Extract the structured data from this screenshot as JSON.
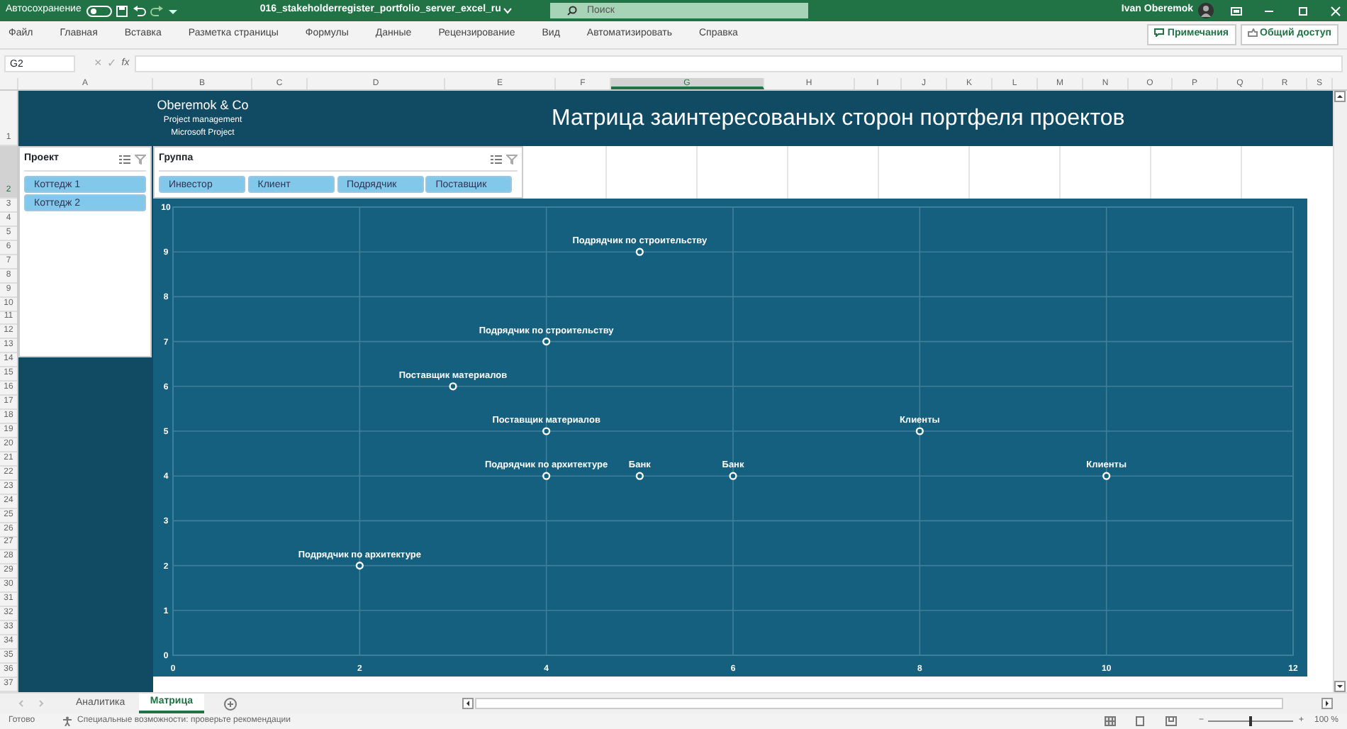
{
  "title_bar": {
    "autosave_label": "Автосохранение",
    "autosave_on": false,
    "filename": "016_stakeholderregister_portfolio_server_excel_ru",
    "search_placeholder": "Поиск",
    "user": "Ivan Oberemok"
  },
  "ribbon_tabs": [
    "Файл",
    "Главная",
    "Вставка",
    "Разметка страницы",
    "Формулы",
    "Данные",
    "Рецензирование",
    "Вид",
    "Автоматизировать",
    "Справка"
  ],
  "ribbon_buttons": [
    "Примечания",
    "Общий доступ"
  ],
  "formula_bar": {
    "name_box": "G2",
    "cancel": "×",
    "enter": "✓",
    "function": "fx"
  },
  "columns": [
    {
      "label": "A",
      "selected": false
    },
    {
      "label": "B",
      "selected": false
    },
    {
      "label": "C",
      "selected": false
    },
    {
      "label": "D",
      "selected": false
    },
    {
      "label": "E",
      "selected": false
    },
    {
      "label": "F",
      "selected": false
    },
    {
      "label": "G",
      "selected": true
    },
    {
      "label": "H",
      "selected": false
    },
    {
      "label": "I",
      "selected": false
    },
    {
      "label": "J",
      "selected": false
    },
    {
      "label": "K",
      "selected": false
    },
    {
      "label": "L",
      "selected": false
    },
    {
      "label": "M",
      "selected": false
    },
    {
      "label": "N",
      "selected": false
    },
    {
      "label": "O",
      "selected": false
    },
    {
      "label": "P",
      "selected": false
    },
    {
      "label": "Q",
      "selected": false
    },
    {
      "label": "R",
      "selected": false
    },
    {
      "label": "S",
      "selected": false
    }
  ],
  "rows": [
    {
      "label": "1",
      "selected": false
    },
    {
      "label": "2",
      "selected": true
    },
    {
      "label": "3",
      "selected": false
    },
    {
      "label": "4",
      "selected": false
    },
    {
      "label": "5",
      "selected": false
    },
    {
      "label": "6",
      "selected": false
    },
    {
      "label": "7",
      "selected": false
    },
    {
      "label": "8",
      "selected": false
    },
    {
      "label": "9",
      "selected": false
    },
    {
      "label": "10",
      "selected": false
    },
    {
      "label": "11",
      "selected": false
    },
    {
      "label": "12",
      "selected": false
    },
    {
      "label": "13",
      "selected": false
    },
    {
      "label": "14",
      "selected": false
    },
    {
      "label": "15",
      "selected": false
    },
    {
      "label": "16",
      "selected": false
    },
    {
      "label": "17",
      "selected": false
    },
    {
      "label": "18",
      "selected": false
    },
    {
      "label": "19",
      "selected": false
    },
    {
      "label": "20",
      "selected": false
    },
    {
      "label": "21",
      "selected": false
    },
    {
      "label": "22",
      "selected": false
    },
    {
      "label": "23",
      "selected": false
    },
    {
      "label": "24",
      "selected": false
    },
    {
      "label": "25",
      "selected": false
    },
    {
      "label": "26",
      "selected": false
    },
    {
      "label": "27",
      "selected": false
    },
    {
      "label": "28",
      "selected": false
    },
    {
      "label": "29",
      "selected": false
    },
    {
      "label": "30",
      "selected": false
    },
    {
      "label": "31",
      "selected": false
    },
    {
      "label": "32",
      "selected": false
    },
    {
      "label": "33",
      "selected": false
    },
    {
      "label": "34",
      "selected": false
    },
    {
      "label": "35",
      "selected": false
    },
    {
      "label": "36",
      "selected": false
    },
    {
      "label": "37",
      "selected": false
    }
  ],
  "banner": {
    "company": "Oberemok & Co",
    "line_1": "Project management",
    "line_2": "Microsoft Project",
    "title": "Матрица заинтересованых сторон портфеля проектов"
  },
  "slicers": [
    {
      "title": "Проект",
      "items": [
        {
          "label": "Коттедж 1",
          "selected": true
        },
        {
          "label": "Коттедж 2",
          "selected": true
        }
      ]
    },
    {
      "title": "Группа",
      "items": [
        {
          "label": "Инвестор",
          "selected": true
        },
        {
          "label": "Клиент",
          "selected": true
        },
        {
          "label": "Подрядчик",
          "selected": true
        },
        {
          "label": "Поставщик",
          "selected": true
        }
      ]
    }
  ],
  "chart_data": {
    "type": "scatter",
    "x": [
      5,
      4,
      3,
      4,
      4,
      5,
      6,
      8,
      10,
      2
    ],
    "series": [
      {
        "color": "#ffffff",
        "values": [
          9,
          7,
          6,
          5,
          4,
          4,
          4,
          5,
          4,
          2
        ]
      }
    ],
    "value_labels": [
      "Подрядчик по строительству",
      "Подрядчик по строительству",
      "Поставщик материалов",
      "Поставщик материалов",
      "Подрядчик по архитектуре",
      "Банк",
      "Банк",
      "Клиенты",
      "Клиенты",
      "Подрядчик по архитектуре"
    ],
    "grid": true,
    "xlim": [
      0,
      12
    ],
    "ylim": [
      0,
      10
    ],
    "xticks": [
      0,
      2,
      4,
      6,
      8,
      10,
      12
    ],
    "yticks": [
      0,
      1,
      2,
      3,
      4,
      5,
      6,
      7,
      8,
      9,
      10
    ]
  },
  "sheet_tabs": [
    {
      "label": "Аналитика",
      "selected": false
    },
    {
      "label": "Матрица",
      "selected": true
    }
  ],
  "status_bar": {
    "ready": "Готово",
    "accessibility": "Специальные возможности: проверьте рекомендации",
    "zoom_minus": "−",
    "zoom_plus": "+",
    "zoom": "100 %",
    "level": 0.5
  }
}
